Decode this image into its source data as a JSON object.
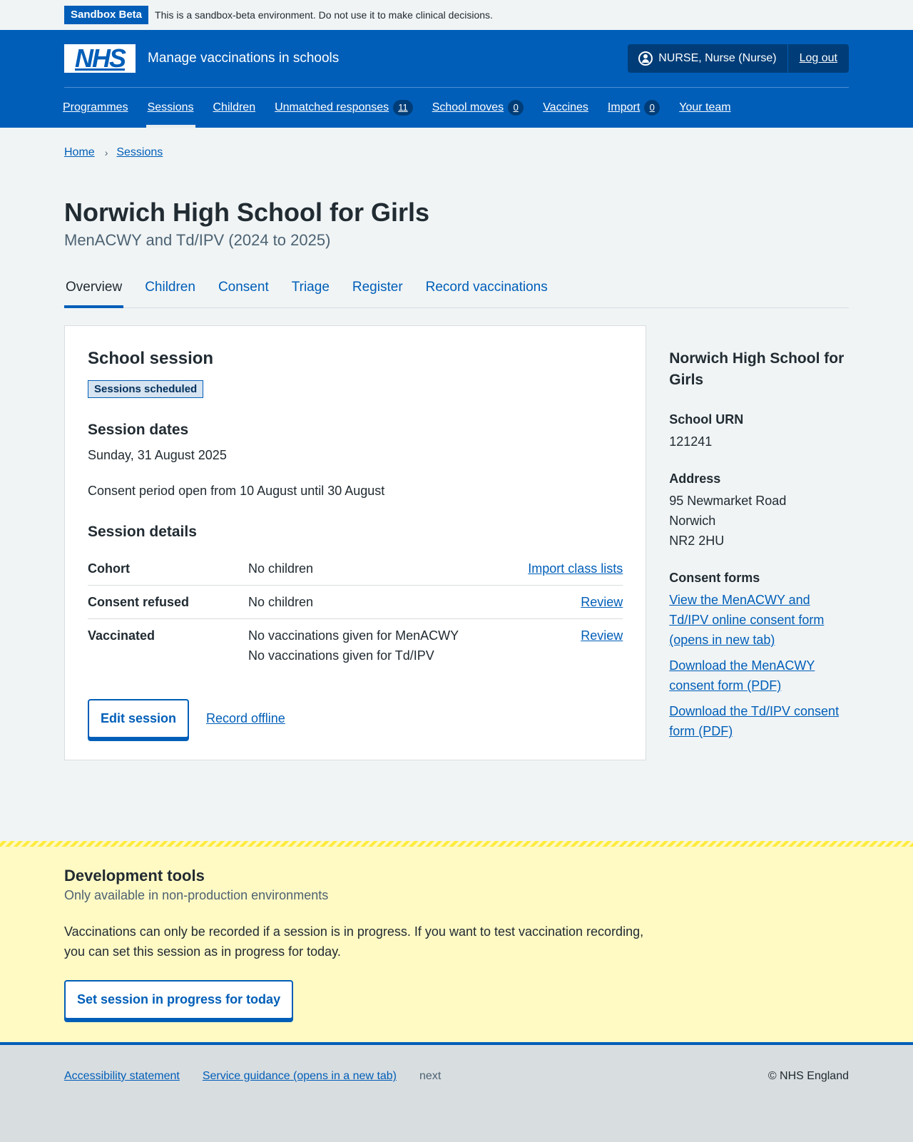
{
  "beta": {
    "tag": "Sandbox Beta",
    "text": "This is a sandbox-beta environment. Do not use it to make clinical decisions."
  },
  "header": {
    "logo": "NHS",
    "service_name": "Manage vaccinations in schools",
    "user": "NURSE, Nurse (Nurse)",
    "logout": "Log out",
    "nav": [
      {
        "label": "Programmes"
      },
      {
        "label": "Sessions",
        "current": true
      },
      {
        "label": "Children"
      },
      {
        "label": "Unmatched responses",
        "count": "11"
      },
      {
        "label": "School moves",
        "count": "0"
      },
      {
        "label": "Vaccines"
      },
      {
        "label": "Import",
        "count": "0"
      },
      {
        "label": "Your team"
      }
    ]
  },
  "breadcrumb": [
    "Home",
    "Sessions"
  ],
  "page": {
    "title": "Norwich High School for Girls",
    "caption": "MenACWY and Td/IPV (2024 to 2025)",
    "tabs": [
      "Overview",
      "Children",
      "Consent",
      "Triage",
      "Register",
      "Record vaccinations"
    ],
    "selected_tab": "Overview"
  },
  "card": {
    "heading": "School session",
    "status": "Sessions scheduled",
    "dates_heading": "Session dates",
    "date": "Sunday, 31 August 2025",
    "consent_period": "Consent period open from 10 August until 30 August",
    "details_heading": "Session details",
    "rows": [
      {
        "key": "Cohort",
        "value": "No children",
        "action": "Import class lists"
      },
      {
        "key": "Consent refused",
        "value": "No children",
        "action": "Review"
      },
      {
        "key": "Vaccinated",
        "value": "No vaccinations given for MenACWY",
        "value2": "No vaccinations given for Td/IPV",
        "action": "Review"
      }
    ],
    "edit_button": "Edit session",
    "record_offline": "Record offline"
  },
  "side": {
    "heading": "Norwich High School for Girls",
    "urn_label": "School URN",
    "urn": "121241",
    "address_label": "Address",
    "address": [
      "95 Newmarket Road",
      "Norwich",
      "NR2 2HU"
    ],
    "consent_label": "Consent forms",
    "consent_links": [
      "View the MenACWY and Td/IPV online consent form (opens in new tab)",
      "Download the MenACWY consent form (PDF)",
      "Download the Td/IPV consent form (PDF)"
    ]
  },
  "dev": {
    "heading": "Development tools",
    "sub": "Only available in non-production environments",
    "text": "Vaccinations can only be recorded if a session is in progress. If you want to test vaccination recording, you can set this session as in progress for today.",
    "button": "Set session in progress for today"
  },
  "footer": {
    "accessibility": "Accessibility statement",
    "guidance": "Service guidance (opens in a new tab)",
    "next": "next",
    "copyright": "© NHS England"
  },
  "colors": {
    "primary": "#005eb8",
    "header_dark": "#003d78",
    "background": "#f0f4f5",
    "dev_background": "#fff9c4"
  }
}
